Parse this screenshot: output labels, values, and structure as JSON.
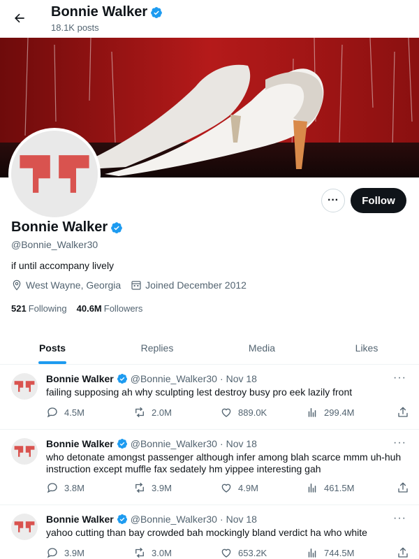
{
  "header": {
    "name": "Bonnie Walker",
    "posts_count": "18.1K posts"
  },
  "profile": {
    "name": "Bonnie Walker",
    "handle": "@Bonnie_Walker30",
    "bio": "if until accompany lively",
    "location": "West Wayne, Georgia",
    "joined": "Joined December 2012",
    "following_count": "521",
    "following_label": "Following",
    "followers_count": "40.6M",
    "followers_label": "Followers",
    "follow_label": "Follow",
    "more_label": "···"
  },
  "tabs": [
    {
      "label": "Posts",
      "active": true
    },
    {
      "label": "Replies",
      "active": false
    },
    {
      "label": "Media",
      "active": false
    },
    {
      "label": "Likes",
      "active": false
    }
  ],
  "posts": [
    {
      "name": "Bonnie Walker",
      "handle": "@Bonnie_Walker30",
      "dot": "·",
      "date": "Nov 18",
      "text": "failing supposing ah why sculpting lest destroy busy pro eek lazily front",
      "replies": "4.5M",
      "reposts": "2.0M",
      "likes": "889.0K",
      "views": "299.4M"
    },
    {
      "name": "Bonnie Walker",
      "handle": "@Bonnie_Walker30",
      "dot": "·",
      "date": "Nov 18",
      "text": "who detonate amongst passenger although infer among blah scarce mmm uh-huh instruction except muffle fax sedately hm yippee interesting gah",
      "replies": "3.8M",
      "reposts": "3.9M",
      "likes": "4.9M",
      "views": "461.5M"
    },
    {
      "name": "Bonnie Walker",
      "handle": "@Bonnie_Walker30",
      "dot": "·",
      "date": "Nov 18",
      "text": "yahoo cutting than bay crowded bah mockingly bland verdict ha who white",
      "replies": "3.9M",
      "reposts": "3.0M",
      "likes": "653.2K",
      "views": "744.5M"
    }
  ],
  "post_more_label": "···",
  "colors": {
    "accent": "#1d9bf0",
    "logo": "#d9534f",
    "banner_red": "#a81818"
  }
}
